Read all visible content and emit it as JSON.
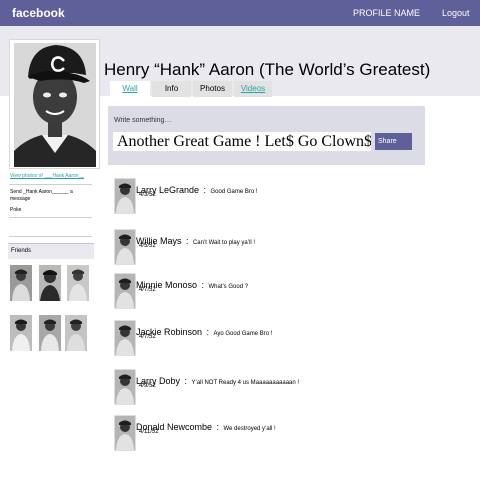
{
  "topbar": {
    "brand": "facebook",
    "profile_name": "PROFILE NAME",
    "logout": "Logout"
  },
  "profile": {
    "title": "Henry “Hank” Aaron (The World’s Greatest)",
    "tabs": [
      {
        "label": "Wall"
      },
      {
        "label": "Info"
      },
      {
        "label": "Photos"
      },
      {
        "label": "Videos"
      }
    ]
  },
  "left": {
    "view_photos": "View photos of ___Hank Aaron__",
    "send_message": "Send _Hank Aaron______ a message",
    "poke": "Poke",
    "friends_header": "Friends"
  },
  "status": {
    "prompt": "Write something…",
    "value": "Another Great Game ! Let$ Go Clown$ !",
    "share_label": "Share"
  },
  "separator": ":",
  "posts": [
    {
      "author": "Larry LeGrande",
      "text": "Good Game Bro !",
      "date": "4/3/52"
    },
    {
      "author": "Willie Mays",
      "text": "Can’t Wait to play ya’ll !",
      "date": "4/5/52"
    },
    {
      "author": "Minnie Monoso",
      "text": "What’s Good   ?",
      "date": "4/7/52"
    },
    {
      "author": "Jackie Robinson",
      "text": "Ayo Good Game Bro !",
      "date": "4/7/52"
    },
    {
      "author": "Larry Doby",
      "text": "Y’all NOT Ready 4 us Maaaaaaaaaaan !",
      "date": "4/9/52"
    },
    {
      "author": "Donald Newcombe",
      "text": "We destroyed y’all !",
      "date": "4/11/52"
    }
  ],
  "colors": {
    "topbar": "#5f5f99",
    "header_band": "#e9e9ef",
    "status_box": "#dcdce6",
    "link": "#2aa1a8"
  }
}
